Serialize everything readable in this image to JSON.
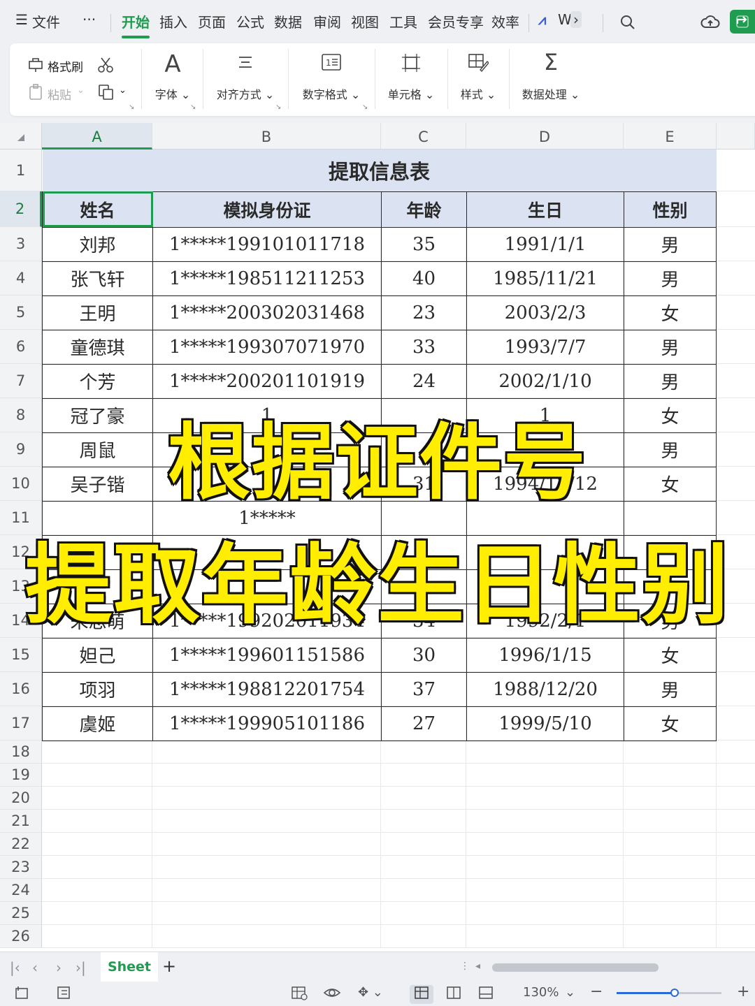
{
  "app": {
    "menu_label": "文件",
    "more_label": "···",
    "tabs": [
      "开始",
      "插入",
      "页面",
      "公式",
      "数据",
      "审阅",
      "视图",
      "工具",
      "会员专享",
      "效率"
    ],
    "active_tab": "开始",
    "wps_ai_label": "W"
  },
  "ribbon": {
    "format_painter": "格式刷",
    "paste": "粘贴",
    "font": "字体",
    "align": "对齐方式",
    "number_format": "数字格式",
    "cell": "单元格",
    "style": "样式",
    "data_process": "数据处理",
    "font_glyph": "A",
    "number_glyph": "1",
    "sum_glyph": "Σ"
  },
  "grid": {
    "columns": [
      "A",
      "B",
      "C",
      "D",
      "E"
    ],
    "selected_column": "A",
    "selected_row": "2",
    "row_numbers": [
      "1",
      "2",
      "3",
      "4",
      "5",
      "6",
      "7",
      "8",
      "9",
      "10",
      "11",
      "12",
      "13",
      "14",
      "15",
      "16",
      "17",
      "18",
      "19",
      "20",
      "21",
      "22",
      "23",
      "24",
      "25",
      "26"
    ]
  },
  "table": {
    "title": "提取信息表",
    "headers": [
      "姓名",
      "模拟身份证",
      "年龄",
      "生日",
      "性别"
    ],
    "rows": [
      [
        "刘邦",
        "1*****199101011718",
        "35",
        "1991/1/1",
        "男"
      ],
      [
        "张飞轩",
        "1*****198511211253",
        "40",
        "1985/11/21",
        "男"
      ],
      [
        "王明",
        "1*****200302031468",
        "23",
        "2003/2/3",
        "女"
      ],
      [
        "童德琪",
        "1*****199307071970",
        "33",
        "1993/7/7",
        "男"
      ],
      [
        "个芳",
        "1*****200201101919",
        "24",
        "2002/1/10",
        "男"
      ],
      [
        "冠了豪",
        "1",
        "",
        "1",
        "女"
      ],
      [
        "周鼠",
        "1",
        "",
        "",
        "男"
      ],
      [
        "吴子锴",
        "1",
        "31",
        "1994/12/12",
        "女"
      ],
      [
        "",
        "1*****",
        "",
        "",
        ""
      ],
      [
        "",
        "",
        "",
        "",
        ""
      ],
      [
        "",
        "",
        "",
        "",
        ""
      ],
      [
        "朱思萌",
        "1*****199202011934",
        "34",
        "1992/2/1",
        "男"
      ],
      [
        "妲己",
        "1*****199601151586",
        "30",
        "1996/1/15",
        "女"
      ],
      [
        "项羽",
        "1*****198812201754",
        "37",
        "1988/12/20",
        "男"
      ],
      [
        "虞姬",
        "1*****199905101186",
        "27",
        "1999/5/10",
        "女"
      ]
    ]
  },
  "overlay": {
    "line1": "根据证件号",
    "line2": "提取年龄生日性别"
  },
  "sheet": {
    "tab_name": "Sheet",
    "add_label": "+"
  },
  "status": {
    "zoom": "130%",
    "zoom_fraction": 0.55,
    "minus": "−",
    "plus": "+"
  },
  "colors": {
    "accent": "#1f9c4f",
    "header_fill": "#dbe3f2",
    "overlay_fill": "#ffee00",
    "overlay_stroke": "#111111"
  }
}
